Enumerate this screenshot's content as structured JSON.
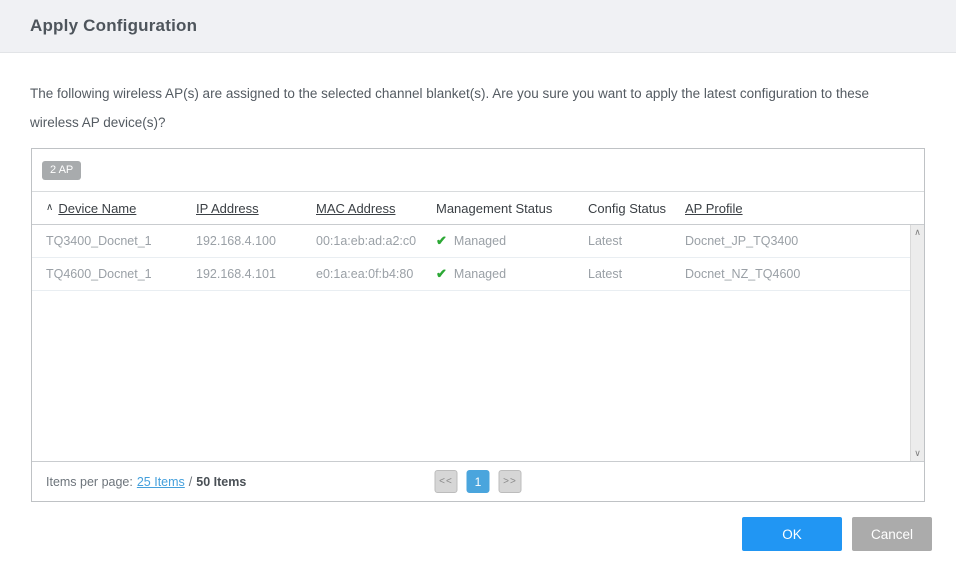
{
  "dialog": {
    "title": "Apply Configuration",
    "message": "The following wireless AP(s) are assigned to the selected channel blanket(s). Are you sure you want to apply the latest configuration to these wireless AP device(s)?",
    "ok_label": "OK",
    "cancel_label": "Cancel"
  },
  "icons": {
    "sort_asc": "∧",
    "check": "✔",
    "scroll_up": "∧",
    "scroll_down": "∨"
  },
  "table": {
    "count_badge": "2 AP",
    "columns": [
      {
        "label": "Device Name",
        "sortable": true,
        "sorted": "asc"
      },
      {
        "label": "IP Address",
        "sortable": true
      },
      {
        "label": "MAC Address",
        "sortable": true
      },
      {
        "label": "Management Status",
        "sortable": false
      },
      {
        "label": "Config Status",
        "sortable": false
      },
      {
        "label": "AP Profile",
        "sortable": true
      }
    ],
    "rows": [
      {
        "device_name": "TQ3400_Docnet_1",
        "ip_address": "192.168.4.100",
        "mac_address": "00:1a:eb:ad:a2:c0",
        "management_status": "Managed",
        "config_status": "Latest",
        "ap_profile": "Docnet_JP_TQ3400"
      },
      {
        "device_name": "TQ4600_Docnet_1",
        "ip_address": "192.168.4.101",
        "mac_address": "e0:1a:ea:0f:b4:80",
        "management_status": "Managed",
        "config_status": "Latest",
        "ap_profile": "Docnet_NZ_TQ4600"
      }
    ],
    "pagination": {
      "items_per_page_label": "Items per page:",
      "items_per_page_link": "25 Items",
      "separator": "/",
      "total_items": "50 Items",
      "prev_label": "<<",
      "current_page": "1",
      "next_label": ">>"
    }
  },
  "colors": {
    "accent_blue": "#2196f3",
    "link_blue": "#45a0dc",
    "active_page_blue": "#4aa5dd",
    "managed_green": "#2ca835",
    "cancel_gray": "#ababab",
    "badge_gray": "#a8abad"
  }
}
